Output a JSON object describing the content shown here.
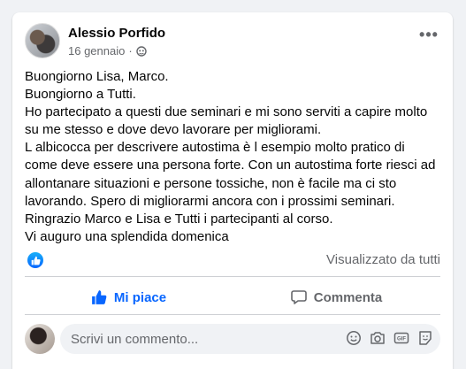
{
  "post": {
    "author": "Alessio Porfido",
    "date": "16 gennaio",
    "separator": "·",
    "body_lines": [
      "Buongiorno Lisa, Marco.",
      "Buongiorno a Tutti.",
      "Ho partecipato a questi due seminari e mi sono serviti a capire molto",
      "su me stesso e dove devo lavorare per migliorami.",
      "L albicocca per descrivere autostima è l esempio molto pratico di",
      "come deve essere una persona forte. Con un autostima forte riesci ad",
      "allontanare situazioni e persone tossiche, non è facile ma ci sto",
      "lavorando. Spero di migliorarmi ancora con i prossimi seminari.",
      "Ringrazio Marco e Lisa e Tutti i partecipanti al corso.",
      "Vi auguro una splendida domenica"
    ]
  },
  "reactions": {
    "seen_by": "Visualizzato da tutti"
  },
  "actions": {
    "like_label": "Mi piace",
    "comment_label": "Commenta"
  },
  "comment_box": {
    "placeholder": "Scrivi un commento..."
  },
  "colors": {
    "accent": "#0866ff",
    "secondary_text": "#65676b"
  }
}
